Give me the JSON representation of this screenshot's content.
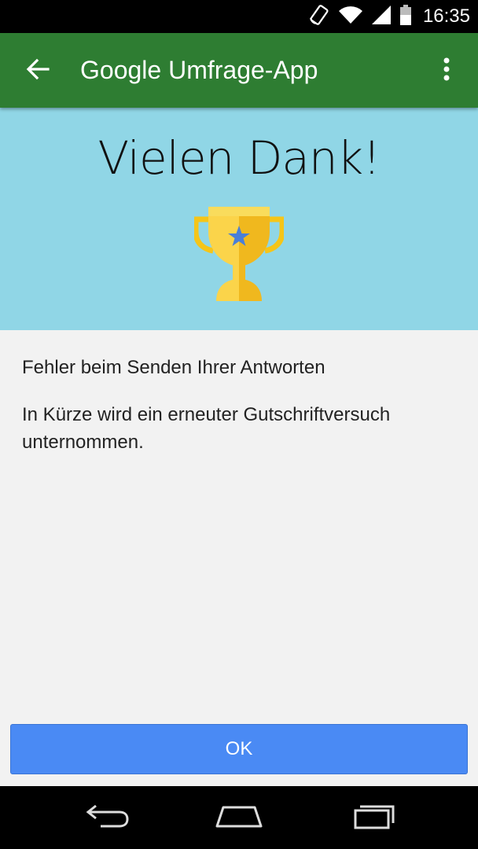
{
  "status_bar": {
    "time": "16:35",
    "icons": [
      "screen-rotation-icon",
      "wifi-icon",
      "signal-icon",
      "battery-icon"
    ]
  },
  "app_bar": {
    "title": "Google Umfrage-App",
    "back_icon": "arrow-back-icon",
    "overflow_icon": "more-vert-icon",
    "color": "#2e7d32"
  },
  "hero": {
    "title": "Vielen Dank!",
    "icon": "trophy-icon",
    "background": "#90d6e6"
  },
  "content": {
    "error_message": "Fehler beim Senden Ihrer Antworten",
    "retry_line1": "In Kürze wird ein erneuter Gutschriftversuch",
    "retry_line2": "unternommen."
  },
  "actions": {
    "ok_label": "OK",
    "ok_color": "#4a8af4"
  },
  "nav_bar": {
    "buttons": [
      "back-icon",
      "home-icon",
      "recents-icon"
    ]
  }
}
